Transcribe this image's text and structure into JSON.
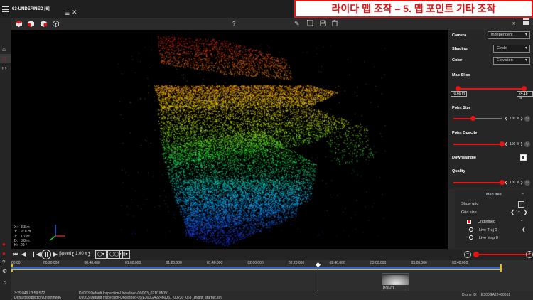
{
  "window": {
    "doc_tab": "63-UNDEFINED [6]",
    "banner": "라이다 맵 조작 – 5. 맵 포인트 기타 조작",
    "help": "?"
  },
  "toolbar": {
    "cubes": [
      "cube-top-view-icon",
      "cube-front-view-icon",
      "cube-side-view-icon",
      "cube-wire-icon"
    ],
    "tools": [
      "pencil-icon",
      "crop-icon",
      "save-icon",
      "trash-icon"
    ]
  },
  "viewport": {
    "coords": [
      {
        "k": "X:",
        "v": "3.3 m"
      },
      {
        "k": "Y:",
        "v": "-0.8 m"
      },
      {
        "k": "Z:",
        "v": "1.7 m"
      },
      {
        "k": "D:",
        "v": "3.8 m"
      },
      {
        "k": "H:",
        "v": "99 °"
      }
    ]
  },
  "panel": {
    "camera_label": "Camera",
    "camera_value": "Independent",
    "shading_label": "Shading",
    "shading_value": "Circle",
    "color_label": "Color",
    "color_value": "Elevation",
    "mapslice_label": "Map Slice",
    "mapslice_min": "-0.66 m",
    "mapslice_max": "24.18 m",
    "pointsize_label": "Point Size",
    "pointsize_value": "100 %",
    "pointsize_fraction": 0.4,
    "opacity_label": "Point Opacity",
    "opacity_value": "100 %",
    "opacity_fraction": 1.0,
    "downsample_label": "Downsample",
    "quality_label": "Quality",
    "quality_value": "100 %",
    "quality_fraction": 1.0
  },
  "maptree": {
    "title": "Map tree",
    "show_grid": "Show grid",
    "grid_size": "Grid size",
    "grid_value": "1x",
    "items": [
      "Undefined",
      "Live Traj 0",
      "Live Map 0"
    ]
  },
  "playback": {
    "speed_label": "Speed",
    "speed_value": "1.00 x"
  },
  "timeline": {
    "ticks": [
      "00:00",
      "00:20.000",
      "00:40.000",
      "01:00.000",
      "01:20.000",
      "01:40.000",
      "02:00.000",
      "02:20.000",
      "02:40.000",
      "03:00.000",
      "03:20.000",
      "03:40.000"
    ],
    "clip_label": "POI-01"
  },
  "status": {
    "left_top": "3:29:849 / 3:59:572",
    "left_bottom": "Default inspection/undefined6",
    "file_top": "D:/063-Default Inspection-Undefined-06/063_0210.MOV",
    "file_bottom": "D:/063-Default Inspection-Undefined-06/E300GA22460051_00230_063_1flight_starnet.stn",
    "drone_label": "Drone ID:",
    "drone_id": "E300GA22460051"
  }
}
